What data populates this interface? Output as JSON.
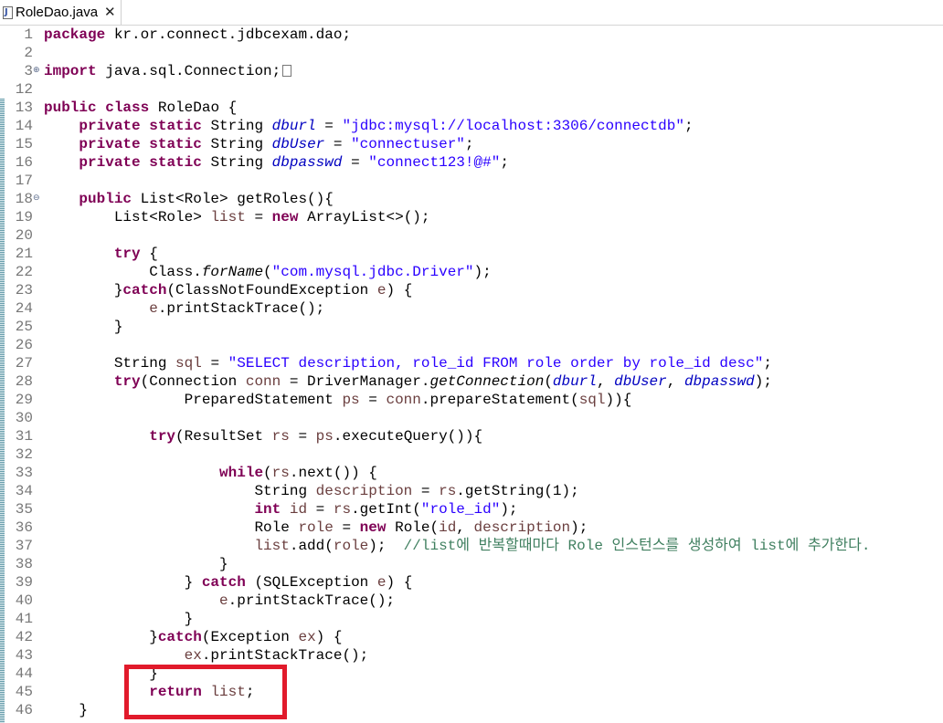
{
  "tab": {
    "title": "RoleDao.java",
    "close_glyph": "✕",
    "icon": "java-file-icon",
    "icon_letter": "J"
  },
  "editor": {
    "lines": [
      {
        "n": "1",
        "segs": [
          {
            "t": "package",
            "c": "kw"
          },
          {
            "t": " kr.or.connect.jdbcexam.dao;"
          }
        ]
      },
      {
        "n": "2",
        "segs": []
      },
      {
        "n": "3",
        "fold": "plus",
        "segs": [
          {
            "t": "import",
            "c": "kw"
          },
          {
            "t": " java.sql.Connection;"
          }
        ],
        "folded": true
      },
      {
        "n": "12",
        "segs": []
      },
      {
        "n": "13",
        "segs": [
          {
            "t": "public",
            "c": "kw"
          },
          {
            "t": " "
          },
          {
            "t": "class",
            "c": "kw"
          },
          {
            "t": " RoleDao {"
          }
        ]
      },
      {
        "n": "14",
        "segs": [
          {
            "t": "    "
          },
          {
            "t": "private",
            "c": "kw"
          },
          {
            "t": " "
          },
          {
            "t": "static",
            "c": "kw"
          },
          {
            "t": " String "
          },
          {
            "t": "dburl",
            "c": "fld"
          },
          {
            "t": " = "
          },
          {
            "t": "\"jdbc:mysql://localhost:3306/connectdb\"",
            "c": "str"
          },
          {
            "t": ";"
          }
        ]
      },
      {
        "n": "15",
        "segs": [
          {
            "t": "    "
          },
          {
            "t": "private",
            "c": "kw"
          },
          {
            "t": " "
          },
          {
            "t": "static",
            "c": "kw"
          },
          {
            "t": " String "
          },
          {
            "t": "dbUser",
            "c": "fld"
          },
          {
            "t": " = "
          },
          {
            "t": "\"connectuser\"",
            "c": "str"
          },
          {
            "t": ";"
          }
        ]
      },
      {
        "n": "16",
        "segs": [
          {
            "t": "    "
          },
          {
            "t": "private",
            "c": "kw"
          },
          {
            "t": " "
          },
          {
            "t": "static",
            "c": "kw"
          },
          {
            "t": " String "
          },
          {
            "t": "dbpasswd",
            "c": "fld"
          },
          {
            "t": " = "
          },
          {
            "t": "\"connect123!@#\"",
            "c": "str"
          },
          {
            "t": ";"
          }
        ]
      },
      {
        "n": "17",
        "segs": []
      },
      {
        "n": "18",
        "fold": "minus",
        "segs": [
          {
            "t": "    "
          },
          {
            "t": "public",
            "c": "kw"
          },
          {
            "t": " List<Role> getRoles(){"
          }
        ]
      },
      {
        "n": "19",
        "segs": [
          {
            "t": "        List<Role> "
          },
          {
            "t": "list",
            "c": "var"
          },
          {
            "t": " = "
          },
          {
            "t": "new",
            "c": "kw"
          },
          {
            "t": " ArrayList<>();"
          }
        ]
      },
      {
        "n": "20",
        "segs": []
      },
      {
        "n": "21",
        "segs": [
          {
            "t": "        "
          },
          {
            "t": "try",
            "c": "kw"
          },
          {
            "t": " {"
          }
        ]
      },
      {
        "n": "22",
        "segs": [
          {
            "t": "            Class."
          },
          {
            "t": "forName",
            "c": "it"
          },
          {
            "t": "("
          },
          {
            "t": "\"com.mysql.jdbc.Driver\"",
            "c": "str"
          },
          {
            "t": ");"
          }
        ]
      },
      {
        "n": "23",
        "segs": [
          {
            "t": "        }"
          },
          {
            "t": "catch",
            "c": "kw"
          },
          {
            "t": "(ClassNotFoundException "
          },
          {
            "t": "e",
            "c": "var"
          },
          {
            "t": ") {"
          }
        ]
      },
      {
        "n": "24",
        "segs": [
          {
            "t": "            "
          },
          {
            "t": "e",
            "c": "var"
          },
          {
            "t": ".printStackTrace();"
          }
        ]
      },
      {
        "n": "25",
        "segs": [
          {
            "t": "        }"
          }
        ]
      },
      {
        "n": "26",
        "segs": []
      },
      {
        "n": "27",
        "segs": [
          {
            "t": "        String "
          },
          {
            "t": "sql",
            "c": "var"
          },
          {
            "t": " = "
          },
          {
            "t": "\"SELECT description, role_id FROM role order by role_id desc\"",
            "c": "str"
          },
          {
            "t": ";"
          }
        ]
      },
      {
        "n": "28",
        "segs": [
          {
            "t": "        "
          },
          {
            "t": "try",
            "c": "kw"
          },
          {
            "t": "(Connection "
          },
          {
            "t": "conn",
            "c": "var"
          },
          {
            "t": " = DriverManager."
          },
          {
            "t": "getConnection",
            "c": "it"
          },
          {
            "t": "("
          },
          {
            "t": "dburl",
            "c": "fld"
          },
          {
            "t": ", "
          },
          {
            "t": "dbUser",
            "c": "fld"
          },
          {
            "t": ", "
          },
          {
            "t": "dbpasswd",
            "c": "fld"
          },
          {
            "t": ");"
          }
        ]
      },
      {
        "n": "29",
        "segs": [
          {
            "t": "                PreparedStatement "
          },
          {
            "t": "ps",
            "c": "var"
          },
          {
            "t": " = "
          },
          {
            "t": "conn",
            "c": "var"
          },
          {
            "t": ".prepareStatement("
          },
          {
            "t": "sql",
            "c": "var"
          },
          {
            "t": ")){"
          }
        ]
      },
      {
        "n": "30",
        "segs": []
      },
      {
        "n": "31",
        "segs": [
          {
            "t": "            "
          },
          {
            "t": "try",
            "c": "kw"
          },
          {
            "t": "(ResultSet "
          },
          {
            "t": "rs",
            "c": "var"
          },
          {
            "t": " = "
          },
          {
            "t": "ps",
            "c": "var"
          },
          {
            "t": ".executeQuery()){"
          }
        ]
      },
      {
        "n": "32",
        "segs": []
      },
      {
        "n": "33",
        "segs": [
          {
            "t": "                    "
          },
          {
            "t": "while",
            "c": "kw"
          },
          {
            "t": "("
          },
          {
            "t": "rs",
            "c": "var"
          },
          {
            "t": ".next()) {"
          }
        ]
      },
      {
        "n": "34",
        "segs": [
          {
            "t": "                        String "
          },
          {
            "t": "description",
            "c": "var"
          },
          {
            "t": " = "
          },
          {
            "t": "rs",
            "c": "var"
          },
          {
            "t": ".getString(1);"
          }
        ]
      },
      {
        "n": "35",
        "segs": [
          {
            "t": "                        "
          },
          {
            "t": "int",
            "c": "kw"
          },
          {
            "t": " "
          },
          {
            "t": "id",
            "c": "var"
          },
          {
            "t": " = "
          },
          {
            "t": "rs",
            "c": "var"
          },
          {
            "t": ".getInt("
          },
          {
            "t": "\"role_id\"",
            "c": "str"
          },
          {
            "t": ");"
          }
        ]
      },
      {
        "n": "36",
        "segs": [
          {
            "t": "                        Role "
          },
          {
            "t": "role",
            "c": "var"
          },
          {
            "t": " = "
          },
          {
            "t": "new",
            "c": "kw"
          },
          {
            "t": " Role("
          },
          {
            "t": "id",
            "c": "var"
          },
          {
            "t": ", "
          },
          {
            "t": "description",
            "c": "var"
          },
          {
            "t": ");"
          }
        ]
      },
      {
        "n": "37",
        "segs": [
          {
            "t": "                        "
          },
          {
            "t": "list",
            "c": "var"
          },
          {
            "t": ".add("
          },
          {
            "t": "role",
            "c": "var"
          },
          {
            "t": ");  "
          },
          {
            "t": "//list에 반복할때마다 Role 인스턴스를 생성하여 list에 추가한다.",
            "c": "cm"
          }
        ]
      },
      {
        "n": "38",
        "segs": [
          {
            "t": "                    }"
          }
        ]
      },
      {
        "n": "39",
        "segs": [
          {
            "t": "                } "
          },
          {
            "t": "catch",
            "c": "kw"
          },
          {
            "t": " (SQLException "
          },
          {
            "t": "e",
            "c": "var"
          },
          {
            "t": ") {"
          }
        ]
      },
      {
        "n": "40",
        "segs": [
          {
            "t": "                    "
          },
          {
            "t": "e",
            "c": "var"
          },
          {
            "t": ".printStackTrace();"
          }
        ]
      },
      {
        "n": "41",
        "segs": [
          {
            "t": "                }"
          }
        ]
      },
      {
        "n": "42",
        "segs": [
          {
            "t": "            }"
          },
          {
            "t": "catch",
            "c": "kw"
          },
          {
            "t": "(Exception "
          },
          {
            "t": "ex",
            "c": "var"
          },
          {
            "t": ") {"
          }
        ]
      },
      {
        "n": "43",
        "segs": [
          {
            "t": "                "
          },
          {
            "t": "ex",
            "c": "var"
          },
          {
            "t": ".printStackTrace();"
          }
        ]
      },
      {
        "n": "44",
        "segs": [
          {
            "t": "            }"
          }
        ]
      },
      {
        "n": "45",
        "segs": [
          {
            "t": "            "
          },
          {
            "t": "return",
            "c": "kw"
          },
          {
            "t": " "
          },
          {
            "t": "list",
            "c": "var"
          },
          {
            "t": ";"
          }
        ]
      },
      {
        "n": "46",
        "segs": [
          {
            "t": "    }"
          }
        ]
      }
    ]
  },
  "colors": {
    "highlight_box": "#e11a2b",
    "keyword": "#7f0055",
    "string": "#2a00ff",
    "field": "#0000c0",
    "local_var": "#6a3e3e",
    "comment": "#3f7f5f"
  }
}
